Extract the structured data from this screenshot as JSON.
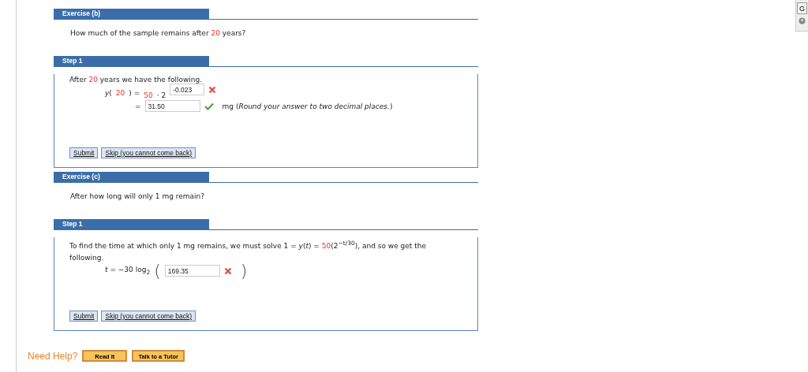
{
  "exercises": [
    {
      "title": "Exercise (b)",
      "question": [
        {
          "kind": "text",
          "text": "How much of the sample remains after "
        },
        {
          "kind": "red",
          "text": "20"
        },
        {
          "kind": "text",
          "text": " years?"
        }
      ],
      "step": {
        "title": "Step 1",
        "intro": [
          {
            "kind": "text",
            "text": "After "
          },
          {
            "kind": "red",
            "text": "20"
          },
          {
            "kind": "text",
            "text": " years we have the following."
          }
        ],
        "lines": [
          [
            {
              "kind": "text",
              "text": "*y*("
            },
            {
              "kind": "red",
              "text": "20"
            },
            {
              "kind": "text",
              "text": ")  ="
            },
            {
              "kind": "red-low",
              "text": "50"
            },
            {
              "kind": "low",
              "text": "· 2"
            },
            {
              "kind": "exponent-input",
              "value": "-0.023",
              "correct": false
            }
          ],
          [
            {
              "kind": "text",
              "text": "="
            },
            {
              "kind": "input",
              "value": "31.50",
              "correct": true
            },
            {
              "kind": "text",
              "text": "mg (*Round your answer to two decimal places.*)"
            }
          ]
        ],
        "buttons": [
          "Submit",
          "Skip (you cannot come back)"
        ]
      }
    },
    {
      "title": "Exercise (c)",
      "question": [
        {
          "kind": "text",
          "text": "After how long will only 1 mg remain?"
        }
      ],
      "step": {
        "title": "Step 1",
        "intro": [
          {
            "kind": "text",
            "text": "To find the time at which only 1 mg remains, we must solve  1 = *y*(*t*) = "
          },
          {
            "kind": "red",
            "text": "50"
          },
          {
            "kind": "text",
            "text": "(2$^{−t/30}$),  and so we get the following."
          }
        ],
        "lines": [
          [
            {
              "kind": "text",
              "text": "*t* = −30 log$_{2}$"
            },
            {
              "kind": "paren",
              "text": "("
            },
            {
              "kind": "input",
              "value": "169.35",
              "correct": false
            },
            {
              "kind": "paren",
              "text": ")"
            }
          ]
        ],
        "buttons": [
          "Submit",
          "Skip (you cannot come back)"
        ]
      }
    }
  ],
  "help": {
    "label": "Need Help?",
    "buttons": [
      "Read It",
      "Talk to a Tutor"
    ]
  },
  "side_panel": {
    "button": "G"
  }
}
